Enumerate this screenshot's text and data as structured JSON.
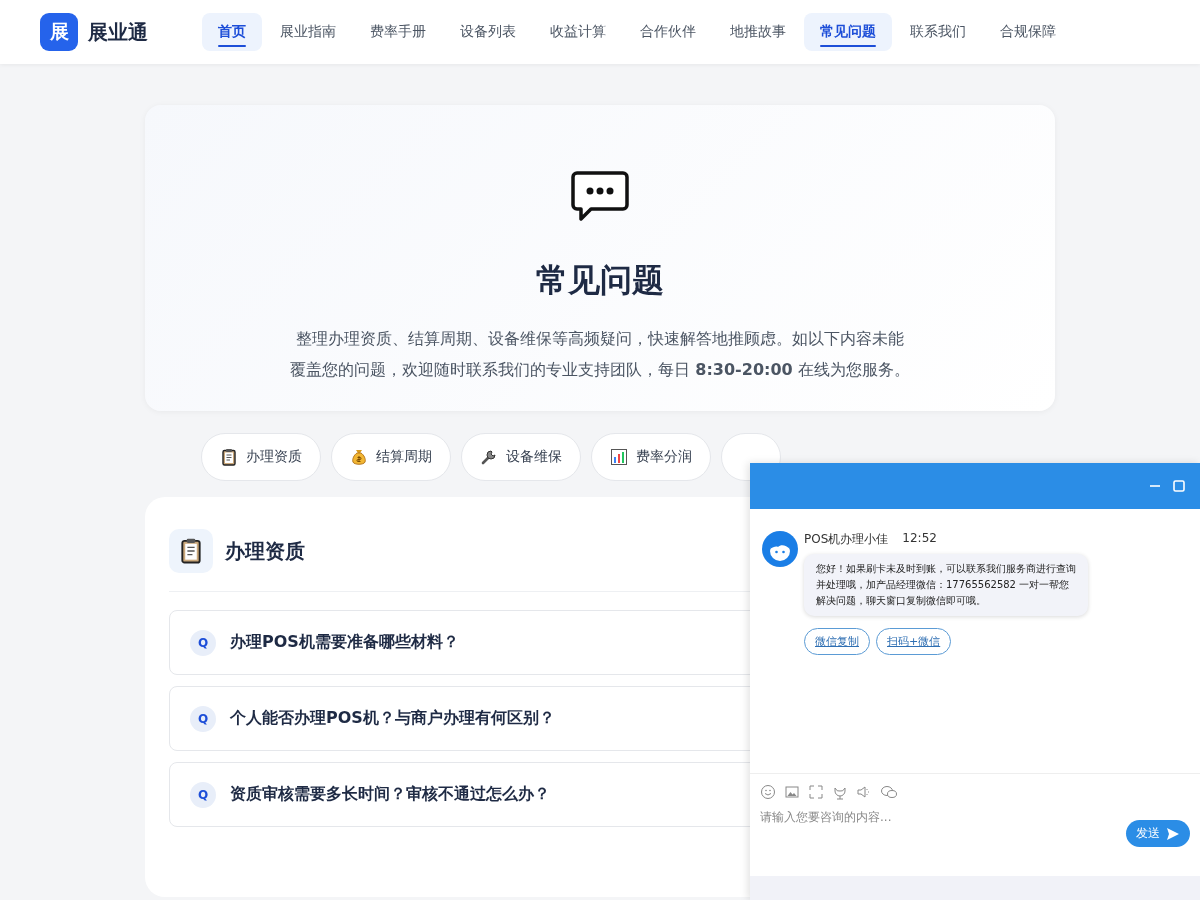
{
  "brand": {
    "logo": "展",
    "name": "展业通"
  },
  "nav": [
    {
      "label": "首页",
      "selected": true
    },
    {
      "label": "展业指南",
      "selected": false
    },
    {
      "label": "费率手册",
      "selected": false
    },
    {
      "label": "设备列表",
      "selected": false
    },
    {
      "label": "收益计算",
      "selected": false
    },
    {
      "label": "合作伙伴",
      "selected": false
    },
    {
      "label": "地推故事",
      "selected": false
    },
    {
      "label": "常见问题",
      "selected": true
    },
    {
      "label": "联系我们",
      "selected": false
    },
    {
      "label": "合规保障",
      "selected": false
    }
  ],
  "hero": {
    "title": "常见问题",
    "description": "整理办理资质、结算周期、设备维保等高频疑问，快速解答地推顾虑。如以下内容未能覆盖您的问题，欢迎随时联系我们的专业支持团队，每日 **8:30-20:00** 在线为您服务。"
  },
  "categories": [
    {
      "kind": "clipboard",
      "label": "办理资质"
    },
    {
      "kind": "moneybag",
      "label": "结算周期"
    },
    {
      "kind": "wrench",
      "label": "设备维保"
    },
    {
      "kind": "chart",
      "label": "费率分润"
    }
  ],
  "section": {
    "kind": "clipboard",
    "title": "办理资质",
    "questions": [
      {
        "badge": "Q",
        "text": "办理POS机需要准备哪些材料？"
      },
      {
        "badge": "Q",
        "text": "个人能否办理POS机？与商户办理有何区别？"
      },
      {
        "badge": "Q",
        "text": "资质审核需要多长时间？审核不通过怎么办？"
      }
    ]
  },
  "chat": {
    "agent": "POS机办理小佳",
    "time": "12:52",
    "message": "您好！如果刷卡未及时到账，可以联系我们服务商进行查询并处理哦，加产品经理微信：17765562582 一对一帮您解决问题，聊天窗口复制微信即可哦。",
    "actions": [
      "微信复制",
      "扫码+微信"
    ],
    "placeholder": "请输入您要咨询的内容...",
    "send": "发送"
  }
}
